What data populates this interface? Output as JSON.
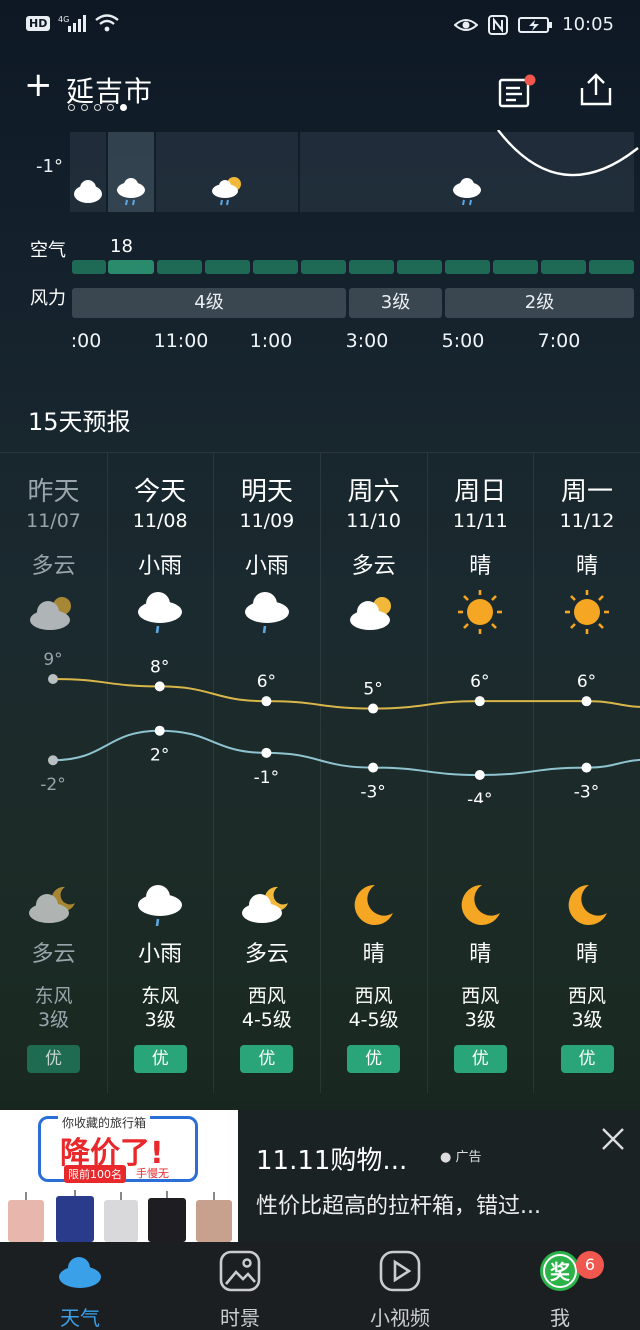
{
  "status_bar": {
    "left": "HD 4G",
    "time": "10:05"
  },
  "header": {
    "city": "延吉市",
    "page_count": 5,
    "active_page": 4
  },
  "hourly": {
    "temp_label": "-1°",
    "air_label": "空气",
    "air_value": "18",
    "wind_label": "风力",
    "wind_segments": [
      "4级",
      "3级",
      "2级"
    ],
    "hours": [
      ":00",
      "11:00",
      "1:00",
      "3:00",
      "5:00",
      "7:00"
    ]
  },
  "forecast": {
    "title": "15天预报",
    "days": [
      {
        "name": "昨天",
        "date": "11/07",
        "cond": "多云",
        "icon": "partly-cloudy-icon",
        "high": "9°",
        "low": "-2°",
        "ncond": "多云",
        "nicon": "cloudy-night-icon",
        "wdir": "东风",
        "wlvl": "3级",
        "aqi": "优"
      },
      {
        "name": "今天",
        "date": "11/08",
        "cond": "小雨",
        "icon": "light-rain-icon",
        "high": "8°",
        "low": "2°",
        "ncond": "小雨",
        "nicon": "light-rain-icon",
        "wdir": "东风",
        "wlvl": "3级",
        "aqi": "优"
      },
      {
        "name": "明天",
        "date": "11/09",
        "cond": "小雨",
        "icon": "light-rain-icon",
        "high": "6°",
        "low": "-1°",
        "ncond": "多云",
        "nicon": "cloudy-night-icon",
        "wdir": "西风",
        "wlvl": "4-5级",
        "aqi": "优"
      },
      {
        "name": "周六",
        "date": "11/10",
        "cond": "多云",
        "icon": "partly-cloudy-icon",
        "high": "5°",
        "low": "-3°",
        "ncond": "晴",
        "nicon": "moon-icon",
        "wdir": "西风",
        "wlvl": "4-5级",
        "aqi": "优"
      },
      {
        "name": "周日",
        "date": "11/11",
        "cond": "晴",
        "icon": "sun-icon",
        "high": "6°",
        "low": "-4°",
        "ncond": "晴",
        "nicon": "moon-icon",
        "wdir": "西风",
        "wlvl": "3级",
        "aqi": "优"
      },
      {
        "name": "周一",
        "date": "11/12",
        "cond": "晴",
        "icon": "sun-icon",
        "high": "6°",
        "low": "-3°",
        "ncond": "晴",
        "nicon": "moon-icon",
        "wdir": "西风",
        "wlvl": "3级",
        "aqi": "优"
      }
    ],
    "highs": [
      9,
      8,
      6,
      5,
      6,
      6
    ],
    "lows": [
      -2,
      2,
      -1,
      -3,
      -4,
      -3
    ],
    "colors": {
      "high_line": "#d8b64a",
      "low_line": "#8fc3cf"
    }
  },
  "ad": {
    "image_top": "你收藏的旅行箱",
    "image_main": "降价了!",
    "image_sub": "限前100名",
    "image_sub2": "手慢无",
    "title": "11.11购物...",
    "badge": "广告",
    "desc": "性价比超高的拉杆箱，错过..."
  },
  "nav": {
    "items": [
      "天气",
      "时景",
      "小视频",
      "我"
    ],
    "badge": "6",
    "reward_glyph": "奖",
    "active_color": "#3aa0e8"
  }
}
